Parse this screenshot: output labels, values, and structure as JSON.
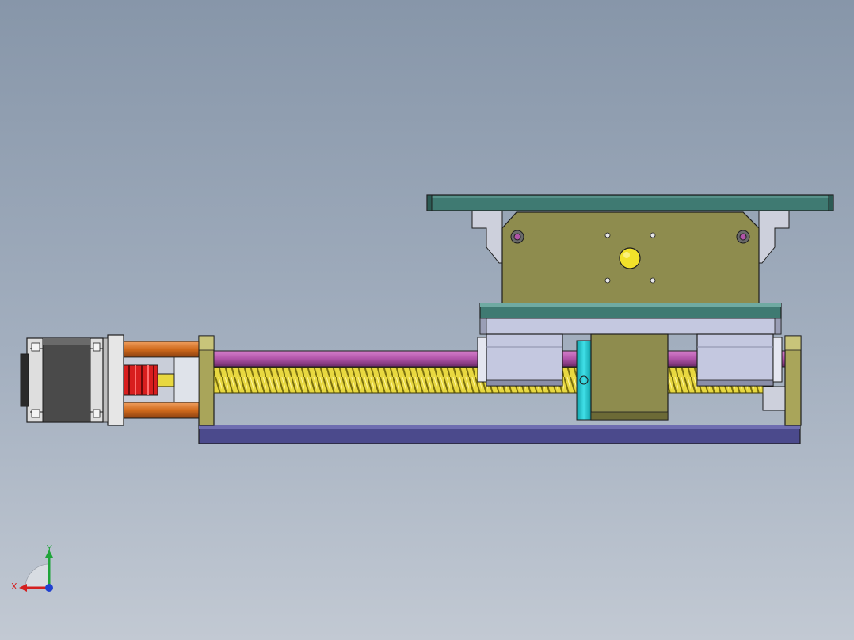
{
  "viewport": {
    "background_top": "#8796a9",
    "background_bottom": "#c2c9d3"
  },
  "model": {
    "parts": [
      {
        "name": "stepper-motor",
        "color": "#4a4a4a"
      },
      {
        "name": "motor-flange",
        "color": "#dcdcdc"
      },
      {
        "name": "flexible-coupling",
        "color": "#d81e1e"
      },
      {
        "name": "guide-rods",
        "color": "#d06a1c"
      },
      {
        "name": "end-plates",
        "color": "#a9a55a"
      },
      {
        "name": "base-plate",
        "color": "#4b4a8c"
      },
      {
        "name": "linear-shaft",
        "color": "#b054a8"
      },
      {
        "name": "lead-screw",
        "color": "#e8d840"
      },
      {
        "name": "carriage-plate",
        "color": "#3f7a72"
      },
      {
        "name": "linear-bearings",
        "color": "#c4c8e0"
      },
      {
        "name": "riser-block",
        "color": "#8e8c4e"
      },
      {
        "name": "top-plate",
        "color": "#3f7a72"
      },
      {
        "name": "nut-bracket",
        "color": "#22c4c8"
      }
    ]
  },
  "triad": {
    "x_label": "X",
    "y_label": "Y",
    "x_color": "#d42020",
    "y_color": "#1fa43a",
    "z_color": "#2040d0"
  }
}
